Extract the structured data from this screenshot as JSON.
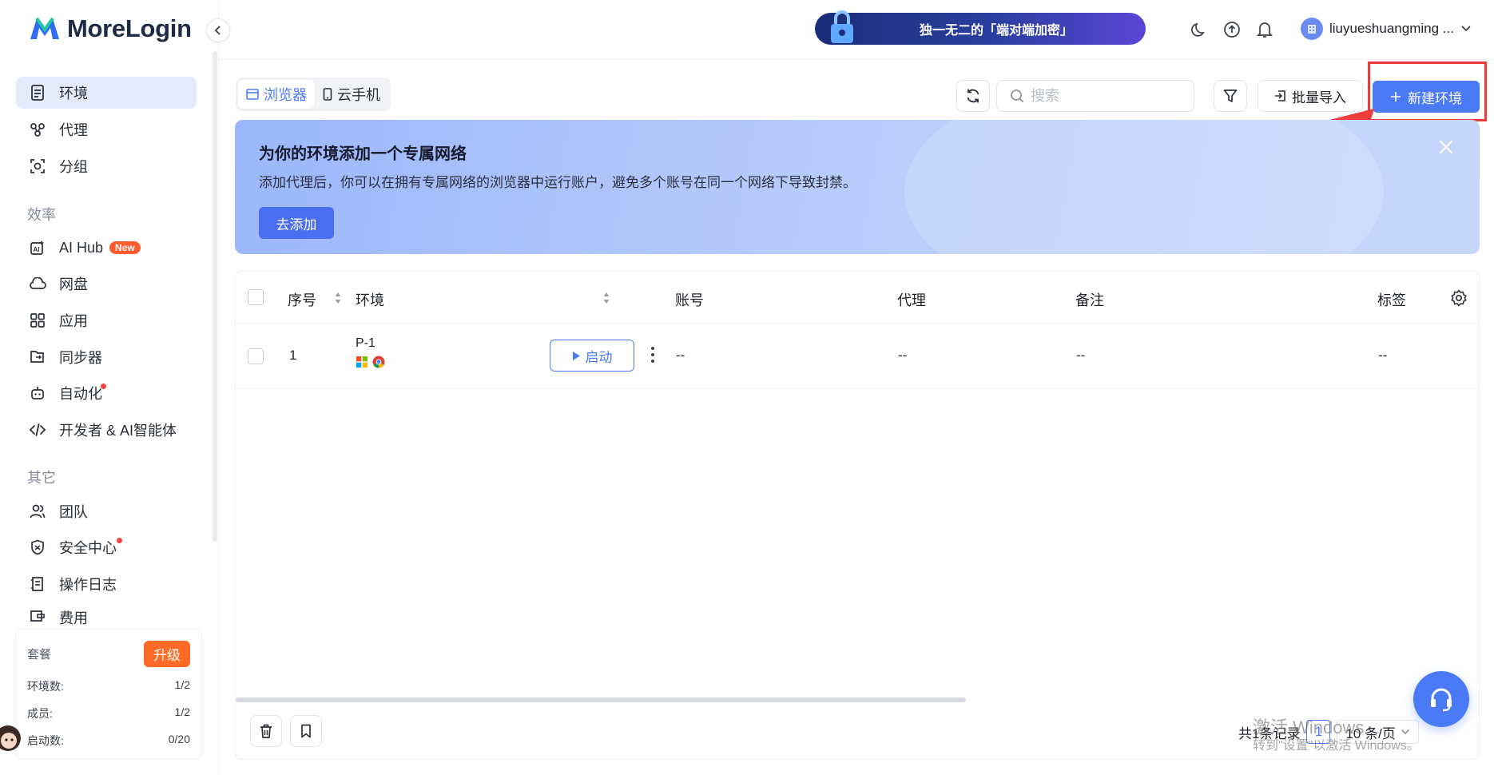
{
  "app": {
    "name": "MoreLogin"
  },
  "sidebar": {
    "main_items": [
      {
        "label": "环境",
        "icon": "document-icon",
        "active": true
      },
      {
        "label": "代理",
        "icon": "proxy-icon"
      },
      {
        "label": "分组",
        "icon": "group-icon"
      }
    ],
    "section_efficiency": "效率",
    "efficiency_items": [
      {
        "label": "AI Hub",
        "icon": "ai-icon",
        "badge": "New"
      },
      {
        "label": "网盘",
        "icon": "cloud-icon"
      },
      {
        "label": "应用",
        "icon": "grid-icon"
      },
      {
        "label": "同步器",
        "icon": "sync-icon"
      },
      {
        "label": "自动化",
        "icon": "robot-icon",
        "dot": true
      },
      {
        "label": "开发者 & AI智能体",
        "icon": "code-icon"
      }
    ],
    "section_other": "其它",
    "other_items": [
      {
        "label": "团队",
        "icon": "team-icon"
      },
      {
        "label": "安全中心",
        "icon": "shield-icon",
        "dot": true
      },
      {
        "label": "操作日志",
        "icon": "log-icon"
      },
      {
        "label": "费用",
        "icon": "wallet-icon"
      }
    ],
    "plan": {
      "title": "套餐",
      "upgrade": "升级",
      "rows": [
        {
          "label": "环境数:",
          "value": "1/2"
        },
        {
          "label": "成员:",
          "value": "1/2"
        },
        {
          "label": "启动数:",
          "value": "0/20"
        }
      ]
    }
  },
  "topbar": {
    "promo": "独一无二的「端对端加密」",
    "username": "liuyueshuangming ..."
  },
  "toolbar": {
    "tabs": [
      {
        "label": "浏览器",
        "active": true
      },
      {
        "label": "云手机",
        "active": false
      }
    ],
    "search_placeholder": "搜索",
    "import_label": "批量导入",
    "new_label": "新建环境"
  },
  "banner": {
    "title": "为你的环境添加一个专属网络",
    "description": "添加代理后，你可以在拥有专属网络的浏览器中运行账户，避免多个账号在同一个网络下导致封禁。",
    "button": "去添加"
  },
  "table": {
    "columns": [
      "序号",
      "环境",
      "账号",
      "代理",
      "备注",
      "标签"
    ],
    "rows": [
      {
        "index": "1",
        "env_name": "P-1",
        "launch": "启动",
        "account": "--",
        "proxy": "--",
        "note": "--",
        "tag": "--"
      }
    ]
  },
  "pagination": {
    "total": "共1条记录",
    "page": "1",
    "page_size": "10 条/页"
  },
  "watermark": {
    "line1": "激活 Windows",
    "line2": "转到\"设置\"以激活 Windows。"
  },
  "colors": {
    "accent": "#4a7af5",
    "highlight": "#ee3b3b",
    "upgrade": "#ff6a26"
  }
}
